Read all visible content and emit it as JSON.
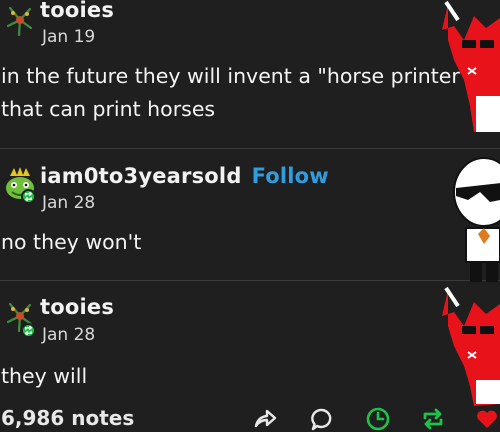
{
  "posts": [
    {
      "username": "tooies",
      "date": "Jan 19",
      "body_lines": [
        "in the future they will invent a \"horse printer\"",
        "that can print horses"
      ],
      "avatar_icon": "fern-avatar-icon"
    },
    {
      "username": "iam0to3yearsold",
      "follow_label": "Follow",
      "date": "Jan 28",
      "body_lines": [
        "no they won't"
      ],
      "avatar_icon": "green-creature-avatar-icon",
      "badge_icon": "reblog-badge-icon"
    },
    {
      "username": "tooies",
      "date": "Jan 28",
      "body_lines": [
        "they will"
      ],
      "avatar_icon": "fern-avatar-icon",
      "badge_icon": "reblog-badge-icon"
    }
  ],
  "footer": {
    "notes": "6,986 notes",
    "actions": [
      "share-icon",
      "reply-icon",
      "queue-clock-icon",
      "reblog-icon",
      "like-icon"
    ]
  },
  "colors": {
    "background": "#1f1f1f",
    "follow_link": "#2f9ee0",
    "reblog_green": "#1ec24a",
    "character_red": "#e8121b"
  }
}
